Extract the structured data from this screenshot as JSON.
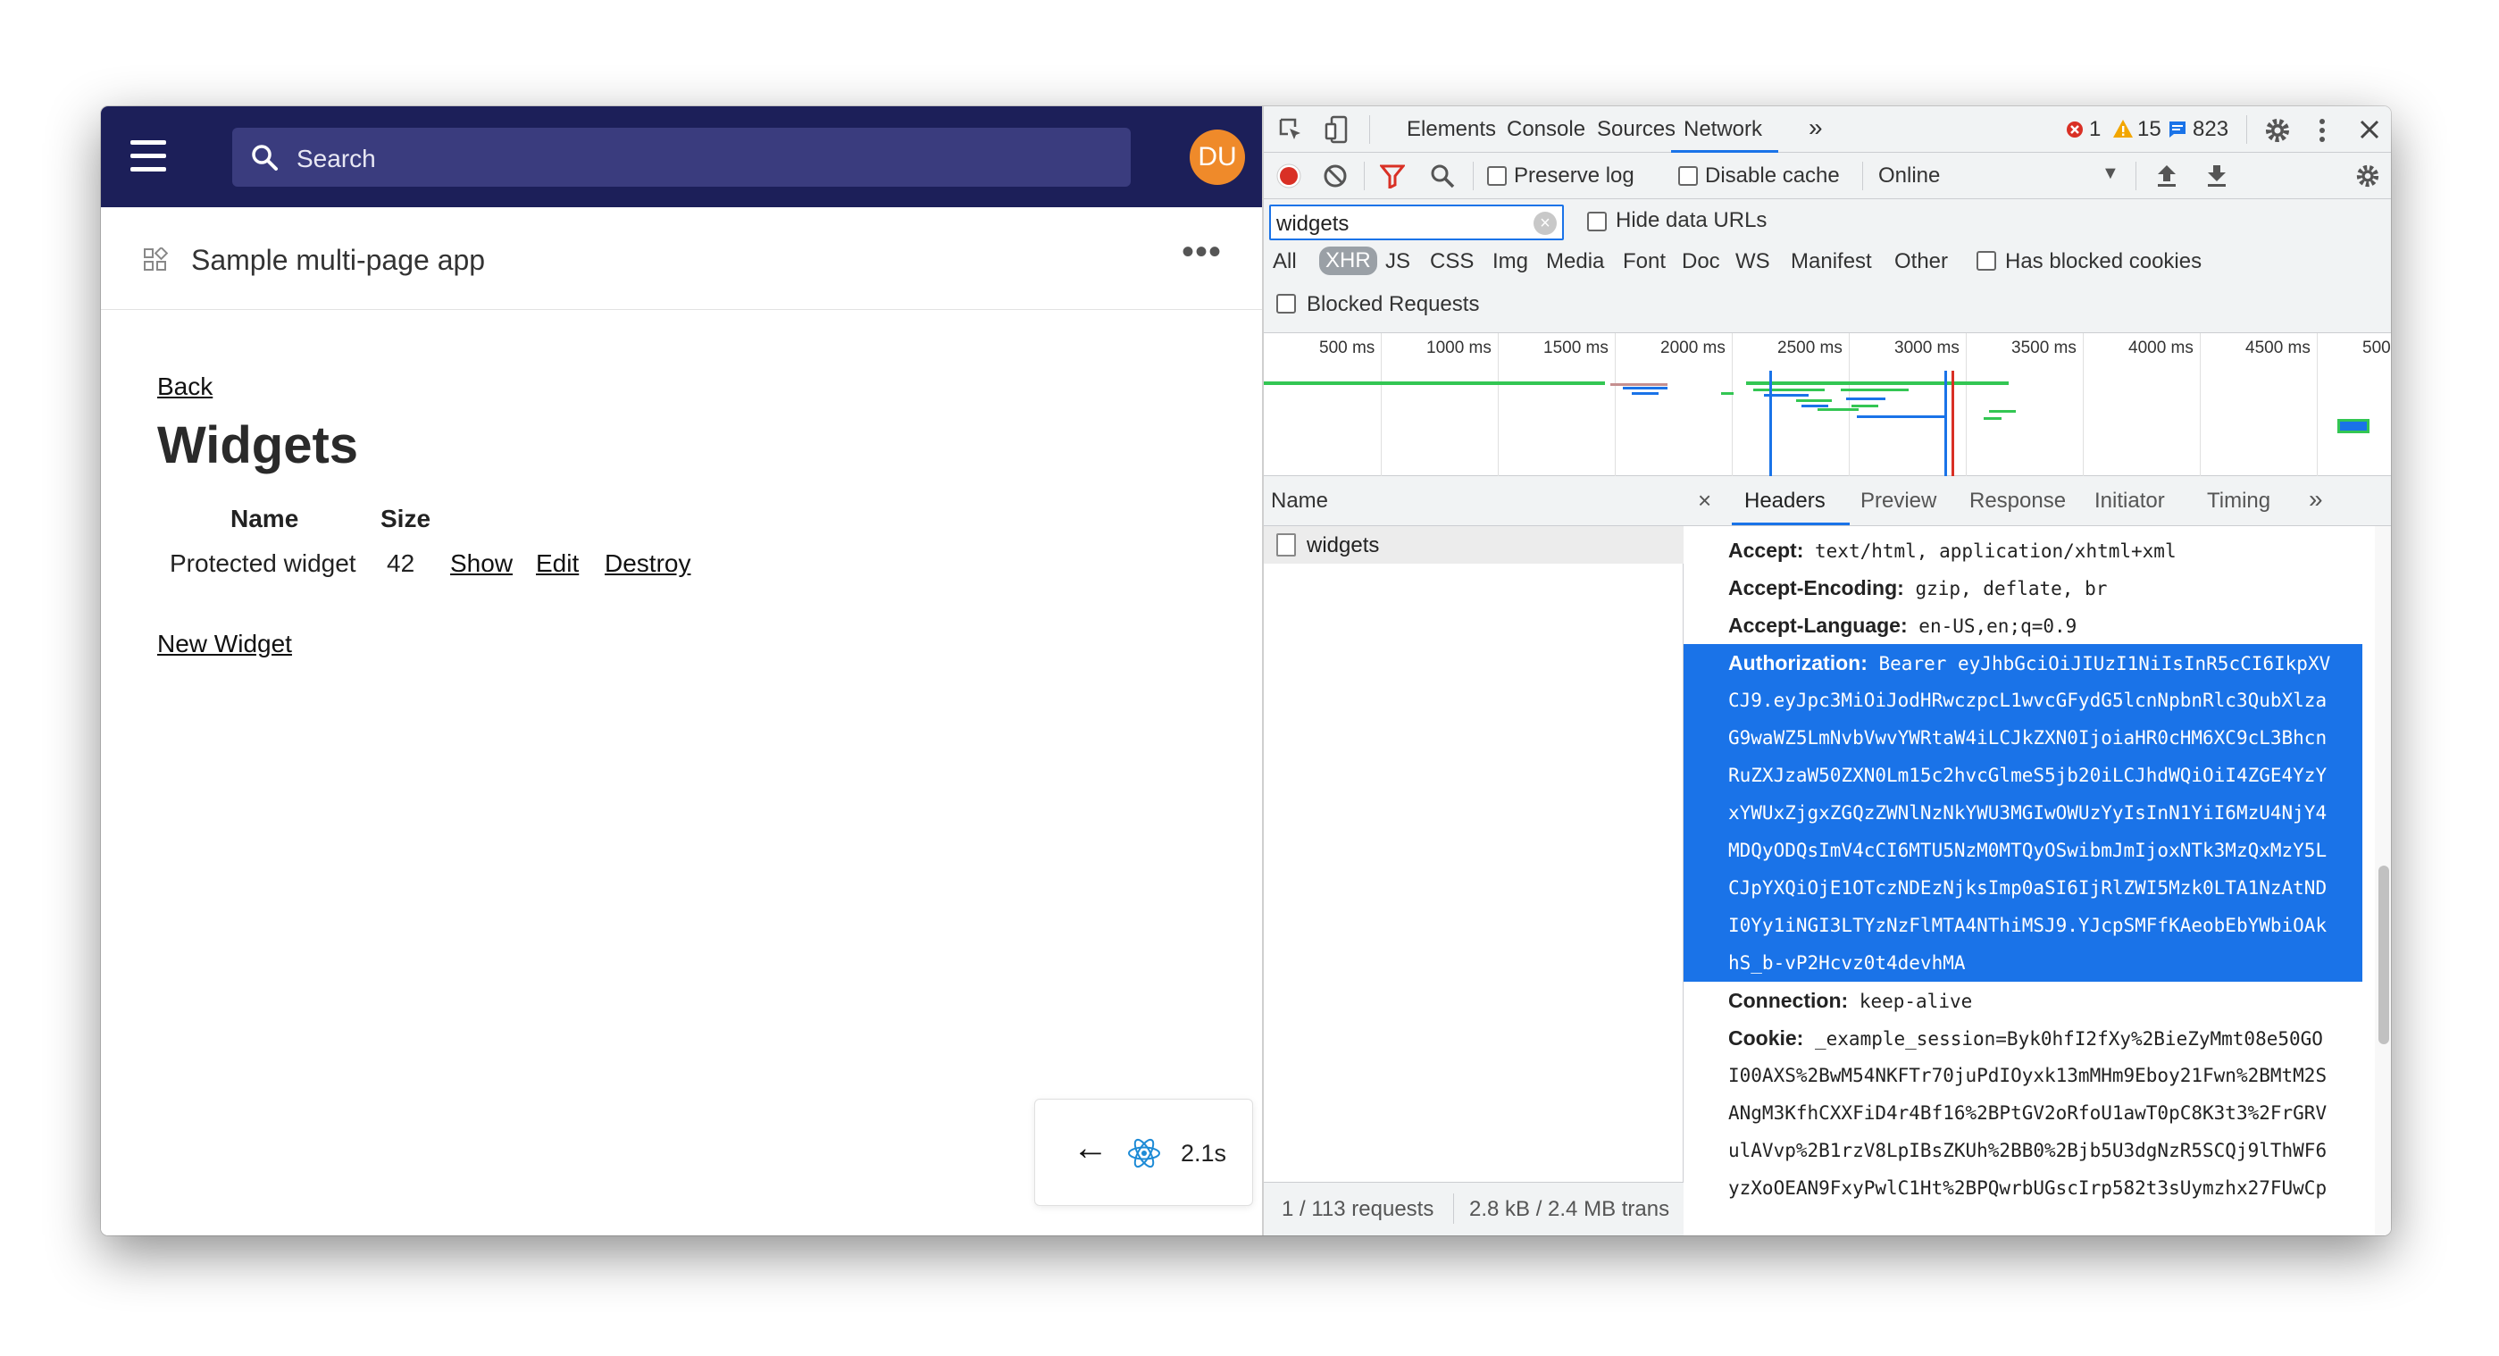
{
  "app": {
    "search_placeholder": "Search",
    "avatar_initials": "DU",
    "avatar_color": "#ef8a2a",
    "topbar_color": "#1c1f59",
    "page_title": "Sample multi-page app",
    "more_label": "•••",
    "back_link": "Back",
    "heading": "Widgets",
    "table": {
      "headers": [
        "Name",
        "Size"
      ],
      "rows": [
        {
          "name": "Protected widget",
          "size": "42",
          "actions": [
            "Show",
            "Edit",
            "Destroy"
          ]
        }
      ]
    },
    "new_link": "New Widget",
    "dev_panel": {
      "back_arrow": "←",
      "time": "2.1s",
      "icon": "react-icon"
    }
  },
  "devtools": {
    "tabs": [
      "Elements",
      "Console",
      "Sources",
      "Network"
    ],
    "active_tab": "Network",
    "more_tabs": "»",
    "errors": "1",
    "warnings": "15",
    "messages": "823",
    "toolbar": {
      "preserve_log": "Preserve log",
      "disable_cache": "Disable cache",
      "throttle": "Online"
    },
    "filter": {
      "value": "widgets",
      "hide_data_urls": "Hide data URLs",
      "types": [
        "All",
        "XHR",
        "JS",
        "CSS",
        "Img",
        "Media",
        "Font",
        "Doc",
        "WS",
        "Manifest",
        "Other"
      ],
      "selected_type": "XHR",
      "has_blocked_cookies": "Has blocked cookies",
      "blocked_requests": "Blocked Requests"
    },
    "timeline_ticks": [
      "500 ms",
      "1000 ms",
      "1500 ms",
      "2000 ms",
      "2500 ms",
      "3000 ms",
      "3500 ms",
      "4000 ms",
      "4500 ms",
      "500"
    ],
    "request_list": {
      "header": "Name",
      "rows": [
        "widgets"
      ],
      "status_requests": "1 / 113 requests",
      "status_transferred": "2.8 kB / 2.4 MB trans"
    },
    "detail_tabs": [
      "Headers",
      "Preview",
      "Response",
      "Initiator",
      "Timing"
    ],
    "active_detail_tab": "Headers",
    "headers": [
      {
        "key": "Accept:",
        "lines": [
          "text/html, application/xhtml+xml"
        ]
      },
      {
        "key": "Accept-Encoding:",
        "lines": [
          "gzip, deflate, br"
        ]
      },
      {
        "key": "Accept-Language:",
        "lines": [
          "en-US,en;q=0.9"
        ]
      },
      {
        "key": "Authorization:",
        "highlighted": true,
        "lines": [
          "Bearer eyJhbGciOiJIUzI1NiIsInR5cCI6IkpXV",
          "CJ9.eyJpc3MiOiJodHRwczpcL1wvcGFydG5lcnNpbnRlc3QubXlza",
          "G9waWZ5LmNvbVwvYWRtaW4iLCJkZXN0IjoiaHR0cHM6XC9cL3Bhcn",
          "RuZXJzaW50ZXN0Lm15c2hvcGlmeS5jb20iLCJhdWQiOiI4ZGE4YzY",
          "xYWUxZjgxZGQzZWNlNzNkYWU3MGIwOWUzYyIsInN1YiI6MzU4NjY4",
          "MDQyODQsImV4cCI6MTU5NzM0MTQyOSwibmJmIjoxNTk3MzQxMzY5L",
          "CJpYXQiOjE1OTczNDEzNjksImp0aSI6IjRlZWI5Mzk0LTA1NzAtND",
          "I0Yy1iNGI3LTYzNzFlMTA4NThiMSJ9.YJcpSMFfKAeobEbYWbiOAk",
          "hS_b-vP2Hcvz0t4devhMA"
        ]
      },
      {
        "key": "Connection:",
        "lines": [
          "keep-alive"
        ]
      },
      {
        "key": "Cookie:",
        "lines": [
          "_example_session=Byk0hfI2fXy%2BieZyMmt08e50GO",
          "I00AXS%2BwM54NKFTr70juPdIOyxk13mMHm9Eboy21Fwn%2BMtM2S",
          "ANgM3KfhCXXFiD4r4Bf16%2BPtGV2oRfoU1awT0pC8K3t3%2FrGRV",
          "ulAVvp%2B1rzV8LpIBsZKUh%2BB0%2Bjb5U3dgNzR5SCQj9lThWF6",
          "yzXoOEAN9FxyPwlC1Ht%2BPQwrbUGscIrp582t3sUymzhx27FUwCp"
        ]
      }
    ]
  }
}
